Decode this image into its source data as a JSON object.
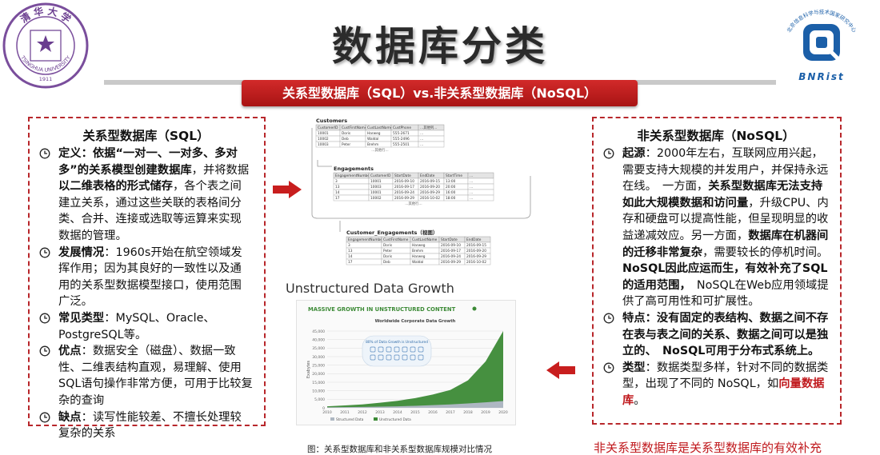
{
  "logo_left": {
    "name": "tsinghua-university-seal",
    "text_top": "清 华 大 学",
    "text_side": "TSINGHUA UNIVERSITY",
    "year": "1911"
  },
  "logo_right": {
    "name": "bnrist-logo",
    "text_arc": "北京信息科学与技术国家研究中心",
    "text_bottom": "BNRist"
  },
  "title": "数据库分类",
  "banner": "关系型数据库（SQL）vs.非关系型数据库（NoSQL）",
  "left_panel": {
    "heading": "关系型数据库（SQL）",
    "items": [
      {
        "segments": [
          {
            "text": "定义：依据“一对一、一对多、多对多”的关系模型创建数据库",
            "bold": true
          },
          {
            "text": "，并将数据"
          },
          {
            "text": "以二维表格的形式储存",
            "bold": true
          },
          {
            "text": "，各个表之间建立关系，通过这些关联的表格间分类、合并、连接或选取等运算来实现数据的管理。"
          }
        ]
      },
      {
        "segments": [
          {
            "text": "发展情况",
            "bold": true
          },
          {
            "text": "：1960s开始在航空领域发挥作用；因为其良好的一致性以及通用的关系型数据模型接口，使用范围广泛。"
          }
        ]
      },
      {
        "segments": [
          {
            "text": "常见类型",
            "bold": true
          },
          {
            "text": "：MySQL、Oracle、PostgreSQL等。"
          }
        ]
      },
      {
        "segments": [
          {
            "text": "优点",
            "bold": true
          },
          {
            "text": "：数据安全（磁盘）、数据一致性、二维表结构直观，易理解、使用SQL语句操作非常方便，可用于比较复杂的查询"
          }
        ]
      },
      {
        "segments": [
          {
            "text": "缺点",
            "bold": true
          },
          {
            "text": "：读写性能较差、不擅长处理较复杂的关系"
          }
        ]
      }
    ]
  },
  "right_panel": {
    "heading": "非关系型数据库（NoSQL）",
    "items": [
      {
        "segments": [
          {
            "text": "起源",
            "bold": true
          },
          {
            "text": "：2000年左右，互联网应用兴起，需要支持大规模的并发用户，并保持永远在线。　一方面，"
          },
          {
            "text": "关系型数据库无法支持如此大规模数据和访问量",
            "bold": true
          },
          {
            "text": "，升级CPU、内存和硬盘可以提高性能，但呈现明显的收益递减效应。另一方面，"
          },
          {
            "text": "数据库在机器间的迁移非常复杂",
            "bold": true
          },
          {
            "text": "，需要较长的停机时间。　"
          },
          {
            "text": "NoSQL因此应运而生，有效补充了SQL的适用范围，",
            "bold": true
          },
          {
            "text": "　NoSQL在Web应用领域提供了高可用性和可扩展性。"
          }
        ]
      },
      {
        "segments": [
          {
            "text": "特点：没有固定的表结构、数据之间不存在表与表之间的关系、数据之间可以是独立的、　NoSQL可用于分布式系统上。",
            "bold": true
          }
        ]
      },
      {
        "segments": [
          {
            "text": "类型",
            "bold": true
          },
          {
            "text": "：数据类型多样，针对不同的数据类型，出现了不同的 NoSQL，如"
          },
          {
            "text": "向量数据库",
            "bold": true,
            "red": true
          },
          {
            "text": "。"
          }
        ]
      }
    ]
  },
  "tables": {
    "customers": {
      "title": "Customers",
      "headers": [
        "CustomerID",
        "CustFirstName",
        "CustLastName",
        "CustPhone",
        "…其他列…"
      ],
      "rows": [
        [
          "10001",
          "Doris",
          "Harweg",
          "555-2671",
          "…"
        ],
        [
          "10002",
          "Deb",
          "Waldal",
          "555-2496",
          "…"
        ],
        [
          "10003",
          "Peter",
          "Brehm",
          "555-2501",
          "…"
        ]
      ],
      "more": "…其他行…"
    },
    "engagements": {
      "title": "Engagements",
      "headers": [
        "EngagementNumber",
        "CustomerID",
        "StartDate",
        "EndDate",
        "StartTime",
        "…"
      ],
      "rows": [
        [
          "3",
          "10001",
          "2016-09-10",
          "2016-09-15",
          "13:00",
          "…"
        ],
        [
          "13",
          "10003",
          "2016-09-17",
          "2016-09-20",
          "20:00",
          "…"
        ],
        [
          "14",
          "10001",
          "2016-09-24",
          "2016-09-29",
          "16:00",
          "…"
        ],
        [
          "17",
          "10002",
          "2016-09-29",
          "2016-10-02",
          "18:00",
          "…"
        ]
      ],
      "more": "…其他行…"
    },
    "customer_engagements": {
      "title": "Customer_Engagements（视图）",
      "headers": [
        "EngagementNumber",
        "CustFirstName",
        "CustLastName",
        "StartDate",
        "EndDate"
      ],
      "rows": [
        [
          "3",
          "Doris",
          "Harweg",
          "2016-09-10",
          "2016-09-15"
        ],
        [
          "13",
          "Peter",
          "Brehm",
          "2016-09-17",
          "2016-09-20"
        ],
        [
          "14",
          "Doris",
          "Harweg",
          "2016-09-24",
          "2016-09-29"
        ],
        [
          "17",
          "Deb",
          "Waldal",
          "2016-09-29",
          "2016-10-02"
        ]
      ]
    }
  },
  "growth_title": "Unstructured Data Growth",
  "chart_data": {
    "type": "area",
    "title": "Worldwide Corporate Data Growth",
    "headline": "MASSIVE GROWTH IN UNSTRUCTURED CONTENT",
    "annotation": "80% of Data Growth is Unstructured",
    "x": [
      2010,
      2011,
      2012,
      2013,
      2014,
      2015,
      2016,
      2017,
      2018,
      2019,
      2020
    ],
    "ylabel": "Exabytes",
    "ylim": [
      0,
      45000
    ],
    "yticks": [
      0,
      5000,
      10000,
      15000,
      20000,
      25000,
      30000,
      35000,
      40000,
      45000
    ],
    "series": [
      {
        "name": "Structured Data",
        "values": [
          300,
          400,
          500,
          700,
          900,
          1200,
          1600,
          2000,
          2600,
          3200,
          4000
        ],
        "color": "#aeb7c2"
      },
      {
        "name": "Unstructured Data",
        "values": [
          600,
          1000,
          1500,
          2300,
          3200,
          4500,
          6200,
          8500,
          13500,
          24000,
          41000
        ],
        "color": "#3c8a36"
      }
    ],
    "grid": true,
    "legend": "bottom"
  },
  "caption": "图：关系型数据库和非关系型数据库规模对比情况",
  "conclusion": "非关系型数据库是关系型数据库的有效补充",
  "colors": {
    "accent_red": "#c0191d",
    "banner_red": "#b81d1d",
    "tsinghua_purple": "#6a3d8f",
    "bnrist_blue": "#1b5fa8"
  }
}
